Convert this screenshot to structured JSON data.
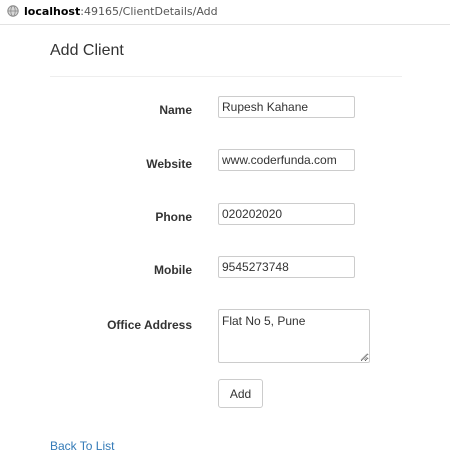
{
  "browser": {
    "url_host": "localhost",
    "url_path": ":49165/ClientDetails/Add",
    "icon": "globe-icon"
  },
  "form": {
    "title": "Add Client",
    "fields": [
      {
        "label": "Name",
        "value": "Rupesh Kahane"
      },
      {
        "label": "Website",
        "value": "www.coderfunda.com"
      },
      {
        "label": "Phone",
        "value": "020202020"
      },
      {
        "label": "Mobile",
        "value": "9545273748"
      },
      {
        "label": "Office Address",
        "value": "Flat No 5, Pune"
      }
    ],
    "submit_label": "Add"
  },
  "links": {
    "back_label": "Back To List"
  },
  "colors": {
    "link": "#337ab7",
    "border": "#cccccc",
    "text": "#333333"
  }
}
